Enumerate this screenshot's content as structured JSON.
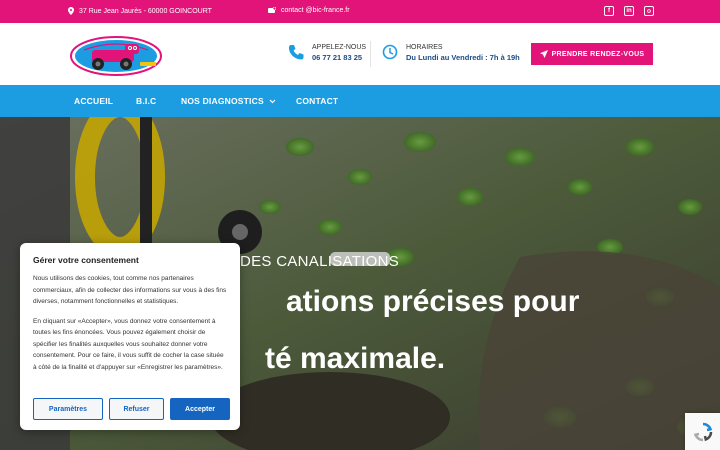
{
  "topbar": {
    "address": "37 Rue Jean Jaurès - 60000 GOINCOURT",
    "email": "contact @bic-france.fr",
    "social": [
      "facebook-icon",
      "linkedin-icon",
      "instagram-icon"
    ]
  },
  "header": {
    "phone_label": "APPELEZ-NOUS",
    "phone_value": "06 77 21 83 25",
    "hours_label": "HORAIRES",
    "hours_value": "Du Lundi au Vendredi : 7h à 19h",
    "cta": "PRENDRE RENDEZ-VOUS"
  },
  "nav": {
    "items": [
      {
        "label": "ACCUEIL"
      },
      {
        "label": "B.I.C"
      },
      {
        "label": "NOS DIAGNOSTICS"
      },
      {
        "label": "CONTACT"
      }
    ]
  },
  "hero": {
    "kicker": "DES CANALISATIONS",
    "title_line1": "ations précises pour",
    "title_line2": "té maximale."
  },
  "cookie": {
    "title": "Gérer votre consentement",
    "text1": "Nous utilisons des cookies, tout comme nos partenaires commerciaux, afin de collecter des informations sur vous à des fins diverses, notamment fonctionnelles et statistiques.",
    "text2": "En cliquant sur «Accepter», vous donnez votre consentement à toutes les fins énoncées. Vous pouvez également choisir de spécifier les finalités auxquelles vous souhaitez donner votre consentement. Pour ce faire, il vous suffit de cocher la case située à côté de la finalité et d'appuyer sur «Enregistrer les paramètres».",
    "btn_settings": "Paramètres",
    "btn_refuse": "Refuser",
    "btn_accept": "Accepter"
  },
  "colors": {
    "brand_pink": "#e2147a",
    "nav_blue": "#1c9de2",
    "dark_blue": "#1c4c86",
    "button_blue": "#1565c0"
  }
}
